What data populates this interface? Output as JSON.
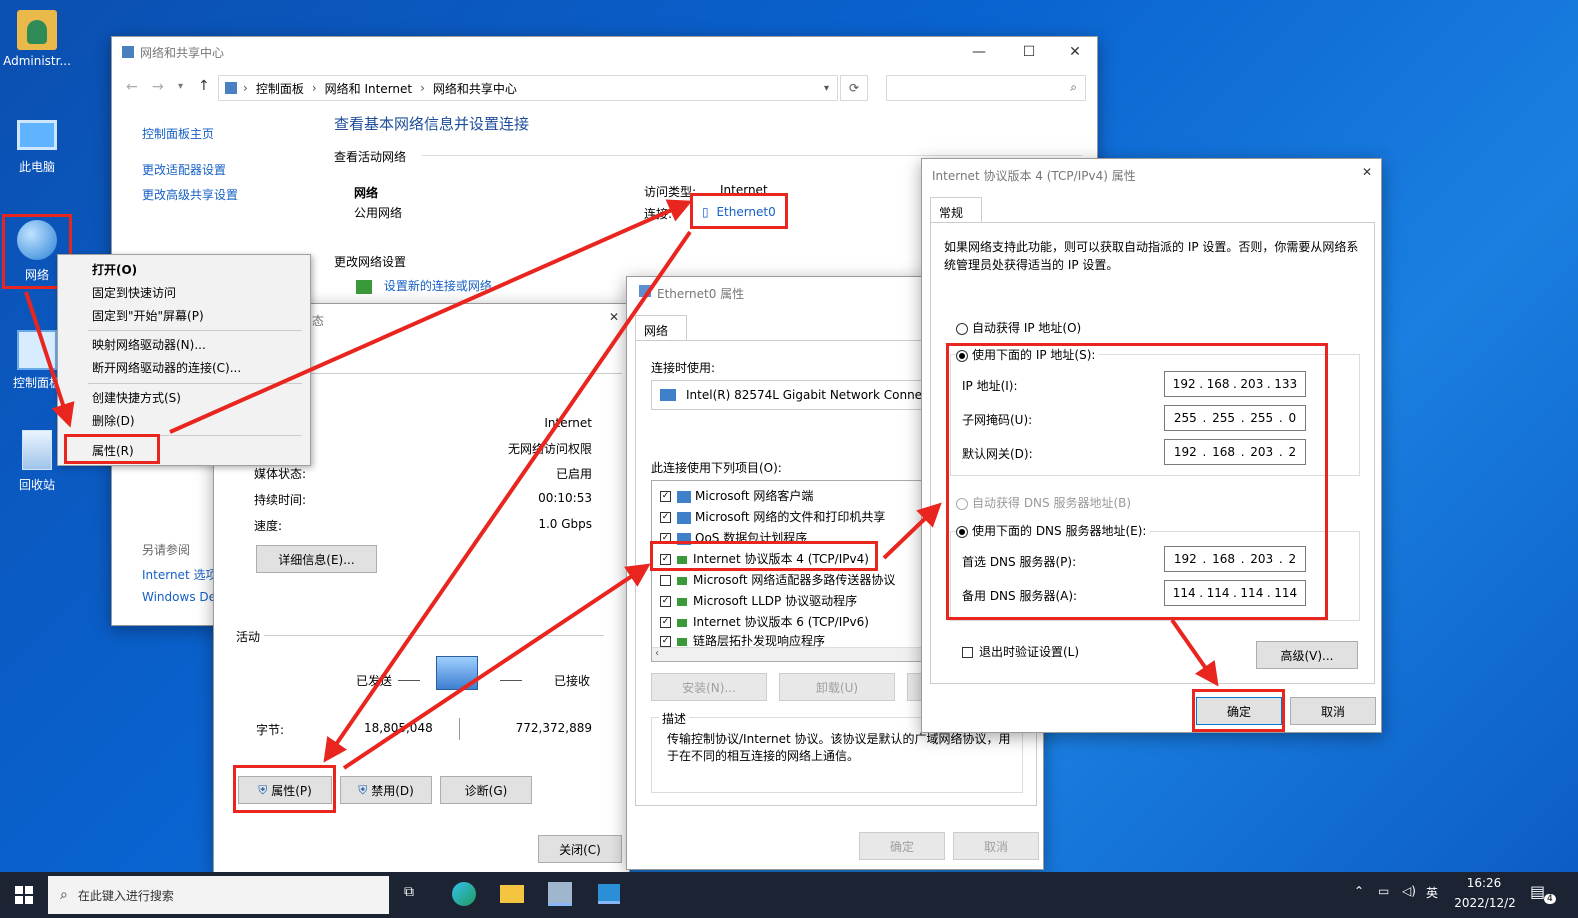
{
  "desktop": {
    "icons": [
      {
        "label": "Administr..."
      },
      {
        "label": "此电脑"
      },
      {
        "label": "网络"
      },
      {
        "label": "控制面板"
      },
      {
        "label": "回收站"
      }
    ]
  },
  "context_menu": {
    "items": [
      "打开(O)",
      "固定到快速访问",
      "固定到\"开始\"屏幕(P)",
      "映射网络驱动器(N)...",
      "断开网络驱动器的连接(C)...",
      "创建快捷方式(S)",
      "删除(D)",
      "属性(R)"
    ]
  },
  "network_center": {
    "title": "网络和共享中心",
    "breadcrumb": [
      "控制面板",
      "网络和 Internet",
      "网络和共享中心"
    ],
    "sidebar": [
      "控制面板主页",
      "更改适配器设置",
      "更改高级共享设置"
    ],
    "see_also_title": "另请参阅",
    "see_also": [
      "Internet 选项",
      "Windows De"
    ],
    "heading": "查看基本网络信息并设置连接",
    "active_label": "查看活动网络",
    "network_name": "网络",
    "network_type": "公用网络",
    "access_type_label": "访问类型:",
    "access_type_value": "Internet",
    "connection_label": "连接:",
    "connection_value": "Ethernet0",
    "change_label": "更改网络设置",
    "new_connection": "设置新的连接或网络"
  },
  "status_window": {
    "title_suffix": "态",
    "rows": [
      {
        "label": "",
        "value": "Internet"
      },
      {
        "label": "",
        "value": "无网络访问权限"
      },
      {
        "label": "媒体状态:",
        "value": "已启用"
      },
      {
        "label": "持续时间:",
        "value": "00:10:53"
      },
      {
        "label": "速度:",
        "value": "1.0 Gbps"
      }
    ],
    "details_button": "详细信息(E)...",
    "activity_label": "活动",
    "sent_label": "已发送",
    "received_label": "已接收",
    "bytes_label": "字节:",
    "bytes_sent": "18,805,048",
    "bytes_received": "772,372,889",
    "properties_button": "属性(P)",
    "disable_button": "禁用(D)",
    "diagnose_button": "诊断(G)",
    "close_button": "关闭(C)"
  },
  "eth_props": {
    "title": "Ethernet0 属性",
    "tab": "网络",
    "connect_using_label": "连接时使用:",
    "adapter": "Intel(R) 82574L Gigabit Network Connect",
    "items_label": "此连接使用下列项目(O):",
    "items": [
      {
        "label": "Microsoft 网络客户端",
        "checked": "✓"
      },
      {
        "label": "Microsoft 网络的文件和打印机共享",
        "checked": "✓"
      },
      {
        "label": "QoS 数据包计划程序",
        "checked": "✓"
      },
      {
        "label": "Internet 协议版本 4 (TCP/IPv4)",
        "checked": "✓"
      },
      {
        "label": "Microsoft 网络适配器多路传送器协议",
        "checked": ""
      },
      {
        "label": "Microsoft LLDP 协议驱动程序",
        "checked": "✓"
      },
      {
        "label": "Internet 协议版本 6 (TCP/IPv6)",
        "checked": "✓"
      },
      {
        "label": "链路层拓扑发现响应程序",
        "checked": "✓"
      }
    ],
    "install_button": "安装(N)...",
    "uninstall_button": "卸载(U)",
    "desc_label": "描述",
    "desc_text": "传输控制协议/Internet 协议。该协议是默认的广域网络协议，用于在不同的相互连接的网络上通信。",
    "ok_button": "确定",
    "cancel_button": "取消"
  },
  "ipv4_props": {
    "title": "Internet 协议版本 4 (TCP/IPv4) 属性",
    "tab": "常规",
    "intro": "如果网络支持此功能，则可以获取自动指派的 IP 设置。否则，你需要从网络系统管理员处获得适当的 IP 设置。",
    "auto_ip": "自动获得 IP 地址(O)",
    "manual_ip": "使用下面的 IP 地址(S):",
    "ip_label": "IP 地址(I):",
    "ip": [
      "192",
      "168",
      "203",
      "133"
    ],
    "mask_label": "子网掩码(U):",
    "mask": [
      "255",
      "255",
      "255",
      "0"
    ],
    "gw_label": "默认网关(D):",
    "gw": [
      "192",
      "168",
      "203",
      "2"
    ],
    "auto_dns": "自动获得 DNS 服务器地址(B)",
    "manual_dns": "使用下面的 DNS 服务器地址(E):",
    "dns1_label": "首选 DNS 服务器(P):",
    "dns1": [
      "192",
      "168",
      "203",
      "2"
    ],
    "dns2_label": "备用 DNS 服务器(A):",
    "dns2": [
      "114",
      "114",
      "114",
      "114"
    ],
    "validate": "退出时验证设置(L)",
    "advanced_button": "高级(V)...",
    "ok_button": "确定",
    "cancel_button": "取消"
  },
  "taskbar": {
    "search_placeholder": "在此键入进行搜索",
    "ime": "英",
    "time": "16:26",
    "date": "2022/12/2",
    "notification_count": "4"
  }
}
